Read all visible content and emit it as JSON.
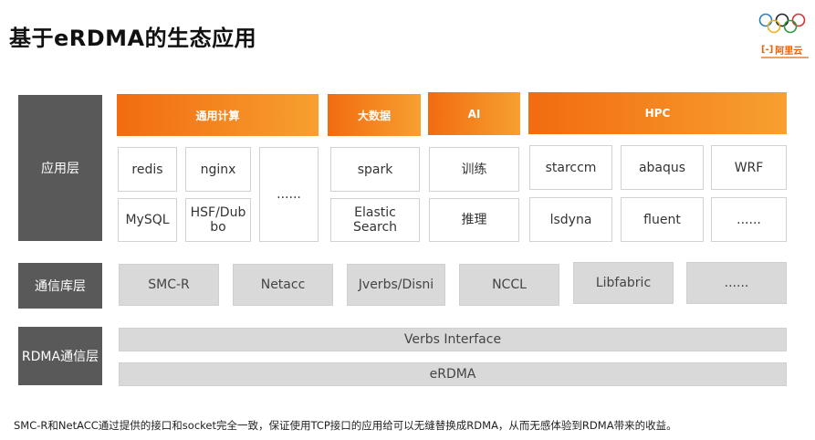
{
  "title": "基于eRDMA的生态应用",
  "logo": {
    "brand_text": "阿里云",
    "brand_mark": "[-]"
  },
  "layers": {
    "app": "应用层",
    "comm": "通信库层",
    "rdma": "RDMA通信层"
  },
  "categories": [
    "通用计算",
    "大数据",
    "AI",
    "HPC"
  ],
  "apps": {
    "general": [
      "redis",
      "nginx",
      "......",
      "MySQL",
      "HSF/Dubbo"
    ],
    "bigdata": [
      "spark",
      "Elastic Search"
    ],
    "ai": [
      "训练",
      "推理"
    ],
    "hpc": [
      "starccm",
      "abaqus",
      "WRF",
      "lsdyna",
      "fluent",
      "......"
    ]
  },
  "libs": [
    "SMC-R",
    "Netacc",
    "Jverbs/Disni",
    "NCCL",
    "Libfabric",
    "......"
  ],
  "rdma": [
    "Verbs Interface",
    "eRDMA"
  ],
  "footnote": "SMC-R和NetACC通过提供的接口和socket完全一致，保证使用TCP接口的应用给可以无缝替换成RDMA，从而无感体验到RDMA带来的收益。",
  "colors": {
    "accent_start": "#f26b10",
    "accent_end": "#f7a030",
    "label_bg": "#595959",
    "lib_bg": "#d9d9d9"
  }
}
